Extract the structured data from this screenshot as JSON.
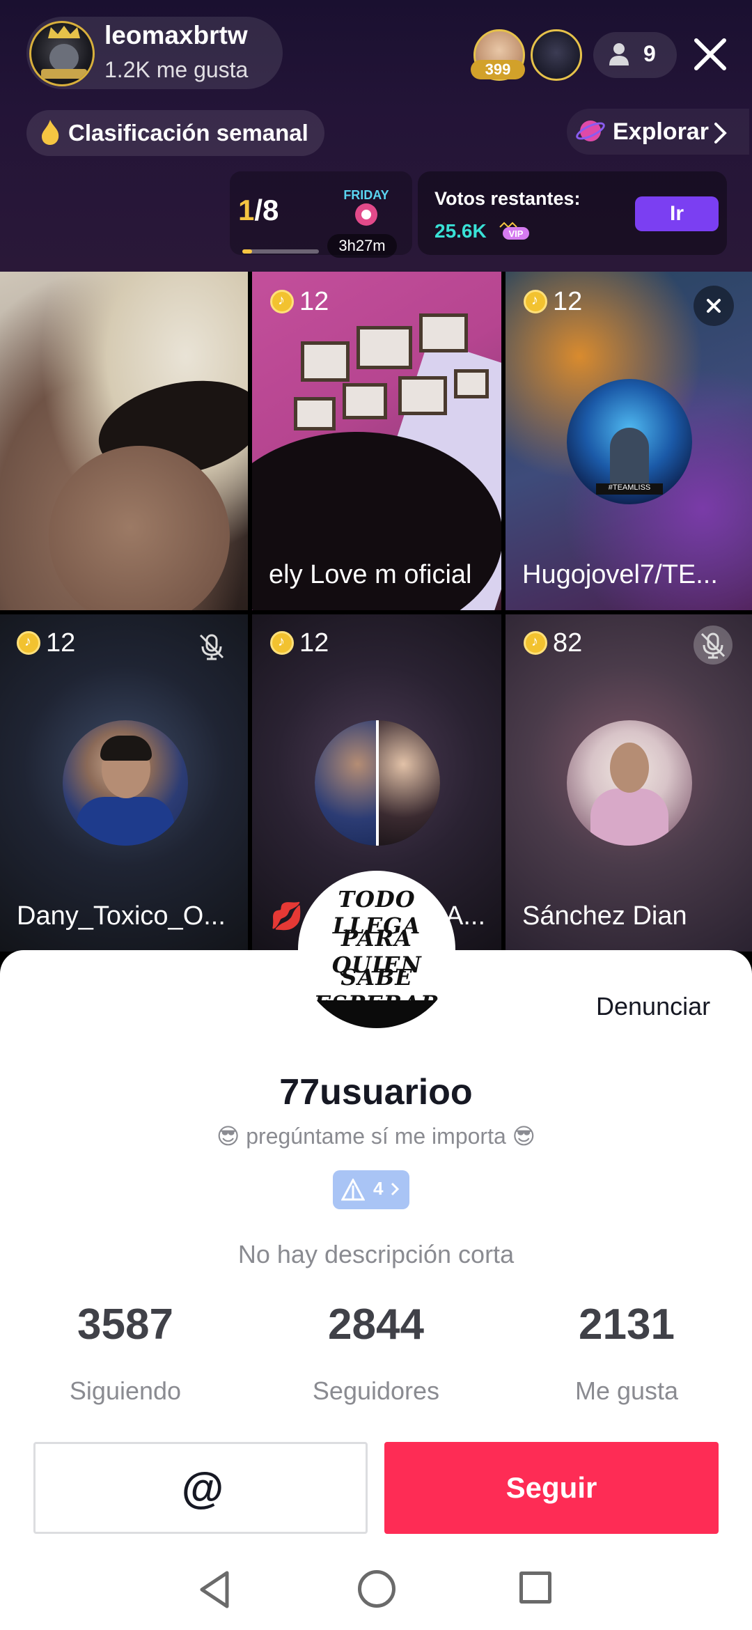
{
  "header": {
    "host_name": "leomaxbrtw",
    "host_likes": "1.2K me gusta",
    "viewer_badge": "399",
    "viewer_count": "9",
    "weekly_ranking": "Clasificación semanal",
    "explore": "Explorar",
    "rank_current": "1",
    "rank_total": "/8",
    "rank_progress": 0.125,
    "event_time": "3h27m",
    "votes_label": "Votos restantes:",
    "votes_value": "25.6K",
    "go_button": "Ir"
  },
  "grid": {
    "tiles": [
      {
        "count": "",
        "name": ""
      },
      {
        "count": "12",
        "name": "ely Love m oficial"
      },
      {
        "count": "12",
        "name": "Hugojovel7/TE..."
      },
      {
        "count": "12",
        "name": "Dany_Toxico_O..."
      },
      {
        "count": "12",
        "name": "A..."
      },
      {
        "count": "82",
        "name": "Sánchez Dian"
      }
    ],
    "kiss_emoji": "💋"
  },
  "profile": {
    "avatar_text": [
      "TODO LLEGA",
      "PARA QUIEN",
      "SABE ESPERAR"
    ],
    "report": "Denunciar",
    "username": "77usuarioo",
    "bio": "😎 pregúntame sí me importa 😎",
    "level": "4",
    "description": "No hay descripción corta",
    "stats": [
      {
        "value": "3587",
        "label": "Siguiendo"
      },
      {
        "value": "2844",
        "label": "Seguidores"
      },
      {
        "value": "2131",
        "label": "Me gusta"
      }
    ],
    "mention_label": "@",
    "follow_label": "Seguir"
  },
  "colors": {
    "follow": "#fe2c55",
    "go_button": "#7b3ff2",
    "votes": "#39e1d6",
    "coin": "#f2c230"
  }
}
